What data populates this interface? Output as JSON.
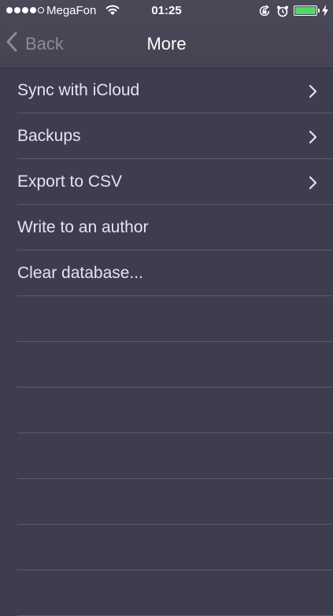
{
  "status_bar": {
    "signal_filled": 4,
    "signal_total": 5,
    "carrier": "MegaFon",
    "time": "01:25",
    "icons": [
      "orientation-lock-icon",
      "alarm-icon",
      "battery-icon",
      "charging-icon"
    ],
    "battery_level": 1.0,
    "battery_color": "#4cd964"
  },
  "nav": {
    "back_label": "Back",
    "back_icon": "chevron-left-icon",
    "title": "More"
  },
  "menu": {
    "items": [
      {
        "label": "Sync with iCloud",
        "has_chevron": true
      },
      {
        "label": "Backups",
        "has_chevron": true
      },
      {
        "label": "Export to CSV",
        "has_chevron": true
      },
      {
        "label": "Write to an author",
        "has_chevron": false
      },
      {
        "label": "Clear database...",
        "has_chevron": false
      }
    ]
  },
  "colors": {
    "background": "#3e3d50",
    "nav_background": "#484756",
    "separator": "#5c5b6e",
    "text": "#e4e4ec",
    "back_text": "#8b8a99"
  }
}
